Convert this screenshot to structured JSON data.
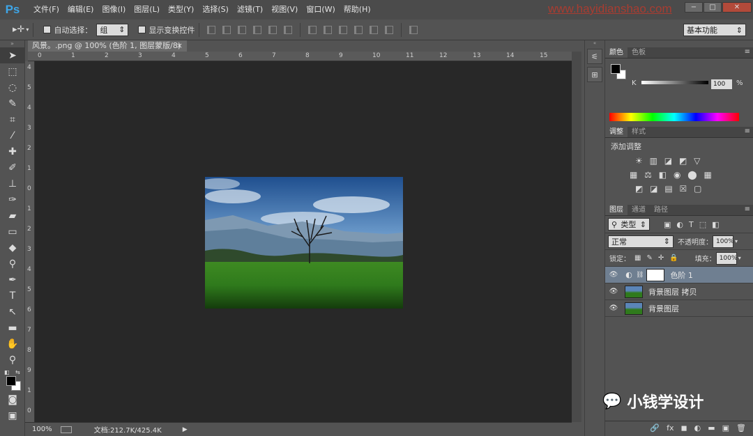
{
  "app": {
    "logo": "Ps",
    "watermark": "www.hayidianshao.com",
    "menus": [
      "文件(F)",
      "编辑(E)",
      "图像(I)",
      "图层(L)",
      "类型(Y)",
      "选择(S)",
      "滤镜(T)",
      "视图(V)",
      "窗口(W)",
      "帮助(H)"
    ],
    "window_buttons": {
      "minimize": "−",
      "maximize": "□",
      "close": "✕"
    }
  },
  "options_bar": {
    "auto_select_label": "自动选择：",
    "auto_select_value": "组",
    "show_transform_label": "显示变换控件",
    "workspace": "基本功能"
  },
  "document": {
    "tab_title": "风景。.png @ 100% (色阶 1, 图层蒙版/8) *",
    "tab_close": "×",
    "zoom": "100%",
    "doc_info": "文档:212.7K/425.4K",
    "ruler_top": [
      "0",
      "1",
      "2",
      "3",
      "4",
      "5",
      "6",
      "7",
      "8",
      "9",
      "10",
      "11",
      "12",
      "13",
      "14",
      "15"
    ],
    "ruler_left": [
      "4",
      "5",
      "4",
      "3",
      "2",
      "1",
      "0",
      "1",
      "2",
      "3",
      "4",
      "5",
      "6",
      "7",
      "8",
      "9",
      "1",
      "0"
    ]
  },
  "color_panel": {
    "tabs": [
      "颜色",
      "色板"
    ],
    "channel": "K",
    "value": "100",
    "unit": "%",
    "swatch_fg": "#000000",
    "swatch_bg": "#ffffff"
  },
  "adjust_panel": {
    "tabs": [
      "调整",
      "样式"
    ],
    "heading": "添加调整",
    "row1": [
      "☀",
      "▥",
      "◪",
      "◩",
      "▽"
    ],
    "row2": [
      "▦",
      "⚖",
      "◧",
      "◉",
      "⬤",
      "▦"
    ],
    "row3": [
      "◩",
      "◪",
      "▤",
      "☒",
      "▢"
    ]
  },
  "layers_panel": {
    "tabs": [
      "图层",
      "通道",
      "路径"
    ],
    "filter_label": "类型",
    "blend_mode": "正常",
    "opacity_label": "不透明度：",
    "opacity_value": "100%",
    "lock_label": "锁定：",
    "fill_label": "填充：",
    "fill_value": "100%",
    "layers": [
      {
        "name": "色阶 1",
        "selected": true,
        "type": "adjustment"
      },
      {
        "name": "背景图层 拷贝",
        "selected": false,
        "type": "image"
      },
      {
        "name": "背景图层",
        "selected": false,
        "type": "image"
      }
    ],
    "footer_icons": [
      "🔗",
      "fx",
      "◼",
      "◐",
      "▬",
      "▣",
      "🗑"
    ]
  },
  "brand": {
    "text": "小钱学设计"
  }
}
